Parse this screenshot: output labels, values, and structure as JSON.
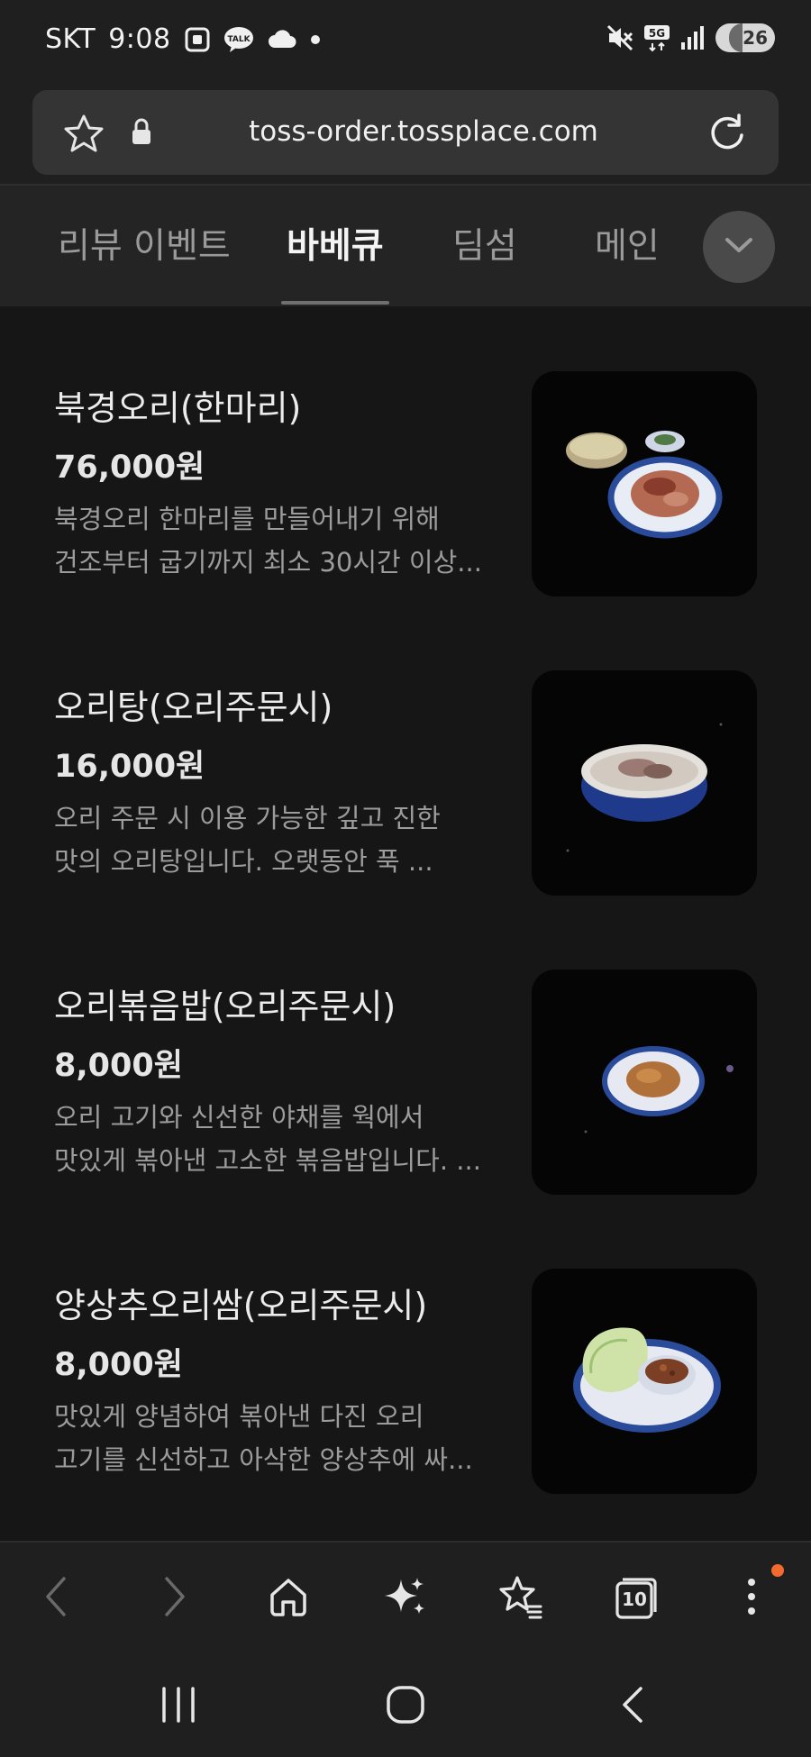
{
  "status_bar": {
    "carrier": "SKT",
    "time": "9:08",
    "talk_badge": "TALK",
    "network": "5G",
    "battery_level": "26",
    "battery_fraction": 0.26,
    "icons": [
      "screenshot-icon",
      "kakaotalk-icon",
      "cloud-icon",
      "dot-icon",
      "mute-icon",
      "5g-icon",
      "signal-icon",
      "battery-icon"
    ]
  },
  "browser": {
    "url": "toss-order.tossplace.com"
  },
  "tabs": [
    {
      "label": "리뷰 이벤트",
      "active": false
    },
    {
      "label": "바베큐",
      "active": true
    },
    {
      "label": "딤섬",
      "active": false
    },
    {
      "label": "메인",
      "active": false
    }
  ],
  "menu_items": [
    {
      "name": "북경오리(한마리)",
      "price": "76,000원",
      "desc_line1": "북경오리 한마리를 만들어내기 위해",
      "desc_line2": "건조부터 굽기까지 최소 30시간 이상..."
    },
    {
      "name": "오리탕(오리주문시)",
      "price": "16,000원",
      "desc_line1": "오리 주문 시 이용 가능한 깊고 진한",
      "desc_line2": "맛의 오리탕입니다. 오랫동안 푹 ..."
    },
    {
      "name": "오리볶음밥(오리주문시)",
      "price": "8,000원",
      "desc_line1": "오리 고기와 신선한 야채를 웍에서",
      "desc_line2": "맛있게 볶아낸 고소한 볶음밥입니다. ..."
    },
    {
      "name": "양상추오리쌈(오리주문시)",
      "price": "8,000원",
      "desc_line1": "맛있게 양념하여 볶아낸 다진 오리",
      "desc_line2": "고기를 신선하고 아삭한 양상추에 싸..."
    }
  ],
  "toolbar": {
    "tab_count": "10"
  },
  "colors": {
    "background": "#161616",
    "accent_dot": "#f26a2e"
  }
}
